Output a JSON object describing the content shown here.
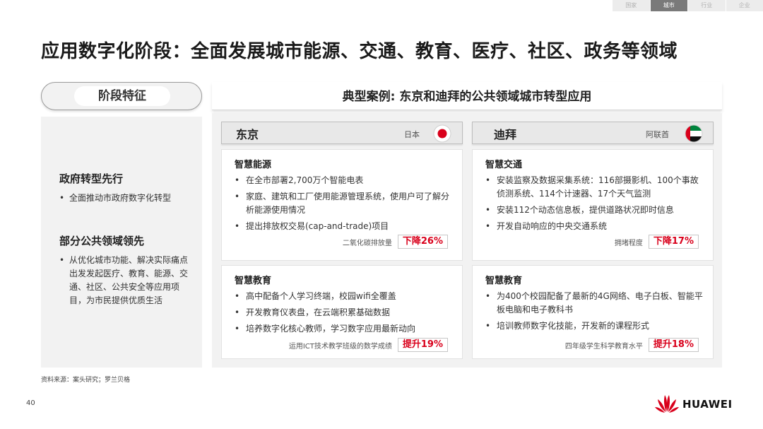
{
  "top_tabs": [
    {
      "label": "国家",
      "active": false
    },
    {
      "label": "城市",
      "active": true
    },
    {
      "label": "行业",
      "active": false
    },
    {
      "label": "企业",
      "active": false
    }
  ],
  "page_title": "应用数字化阶段：全面发展城市能源、交通、教育、医疗、社区、政务等领域",
  "left": {
    "phase_label": "阶段特征",
    "sections": [
      {
        "heading": "政府转型先行",
        "bullets": [
          "全面推动市政府数字化转型"
        ]
      },
      {
        "heading": "部分公共领域领先",
        "bullets": [
          "从优化城市功能、解决实际痛点出发发起医疗、教育、能源、交通、社区、公共安全等应用项目，为市民提供优质生活"
        ]
      }
    ]
  },
  "right": {
    "banner_title": "典型案例: 东京和迪拜的公共领域城市转型应用",
    "cities": [
      {
        "name": "东京",
        "country": "日本",
        "flag_icon": "japan-flag-icon",
        "cards": [
          {
            "title": "智慧能源",
            "bullets": [
              "在全市部署2,700万个智能电表",
              "家庭、建筑和工厂使用能源管理系统，使用户可了解分析能源使用情况",
              "提出排放权交易(cap-and-trade)项目"
            ],
            "metric_label": "二氧化碳排放量",
            "metric_value": "下降26%"
          },
          {
            "title": "智慧教育",
            "bullets": [
              "高中配备个人学习终端，校园wifi全覆盖",
              "开发教育仪表盘，在云端积累基础数据",
              "培养数字化核心教师，学习数字应用最新动向"
            ],
            "metric_label": "运用ICT技术教学班级的数学成绩",
            "metric_value": "提升19%"
          }
        ]
      },
      {
        "name": "迪拜",
        "country": "阿联酋",
        "flag_icon": "uae-flag-icon",
        "cards": [
          {
            "title": "智慧交通",
            "bullets": [
              "安装监察及数据采集系统：116部摄影机、100个事故侦测系统、114个计速器、17个天气监测",
              "安装112个动态信息板，提供道路状况即时信息",
              "开发自动响应的中央交通系统"
            ],
            "metric_label": "拥堵程度",
            "metric_value": "下降17%"
          },
          {
            "title": "智慧教育",
            "bullets": [
              "为400个校园配备了最新的4G网络、电子白板、智能平板电脑和电子教科书",
              "培训教师数字化技能，开发新的课程形式"
            ],
            "metric_label": "四年级学生科学教育水平",
            "metric_value": "提升18%"
          }
        ]
      }
    ]
  },
  "source_note": "资料来源：案头研究；罗兰贝格",
  "page_number": "40",
  "brand": {
    "name": "HUAWEI",
    "accent": "#d9001b"
  }
}
